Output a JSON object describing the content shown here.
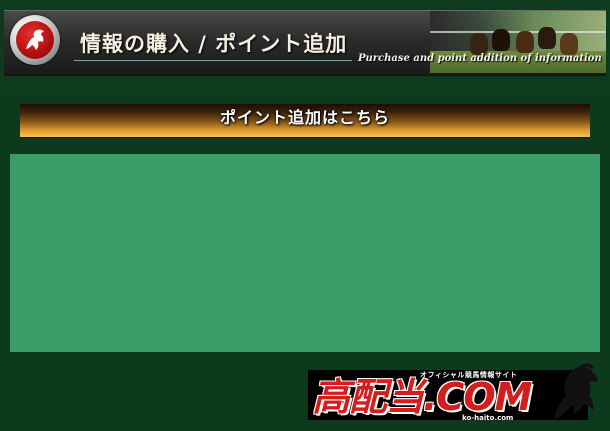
{
  "header": {
    "title": "情報の購入 / ポイント追加",
    "subtitle": "Purchase and point addition of information",
    "logo_icon": "horse-emblem-icon",
    "photo": "horse-race-photo"
  },
  "section": {
    "label": "ポイント追加はこちら"
  },
  "footer": {
    "brand": "高配当.COM",
    "tagline": "オフィシャル競馬情報サイト",
    "url": "ko-haito.com",
    "logo_icon": "horse-silhouette-icon"
  },
  "colors": {
    "background": "#0d3a1c",
    "content_panel": "#3a9d68",
    "accent_orange": "#e09b2f",
    "brand_red": "#d61d1d"
  }
}
